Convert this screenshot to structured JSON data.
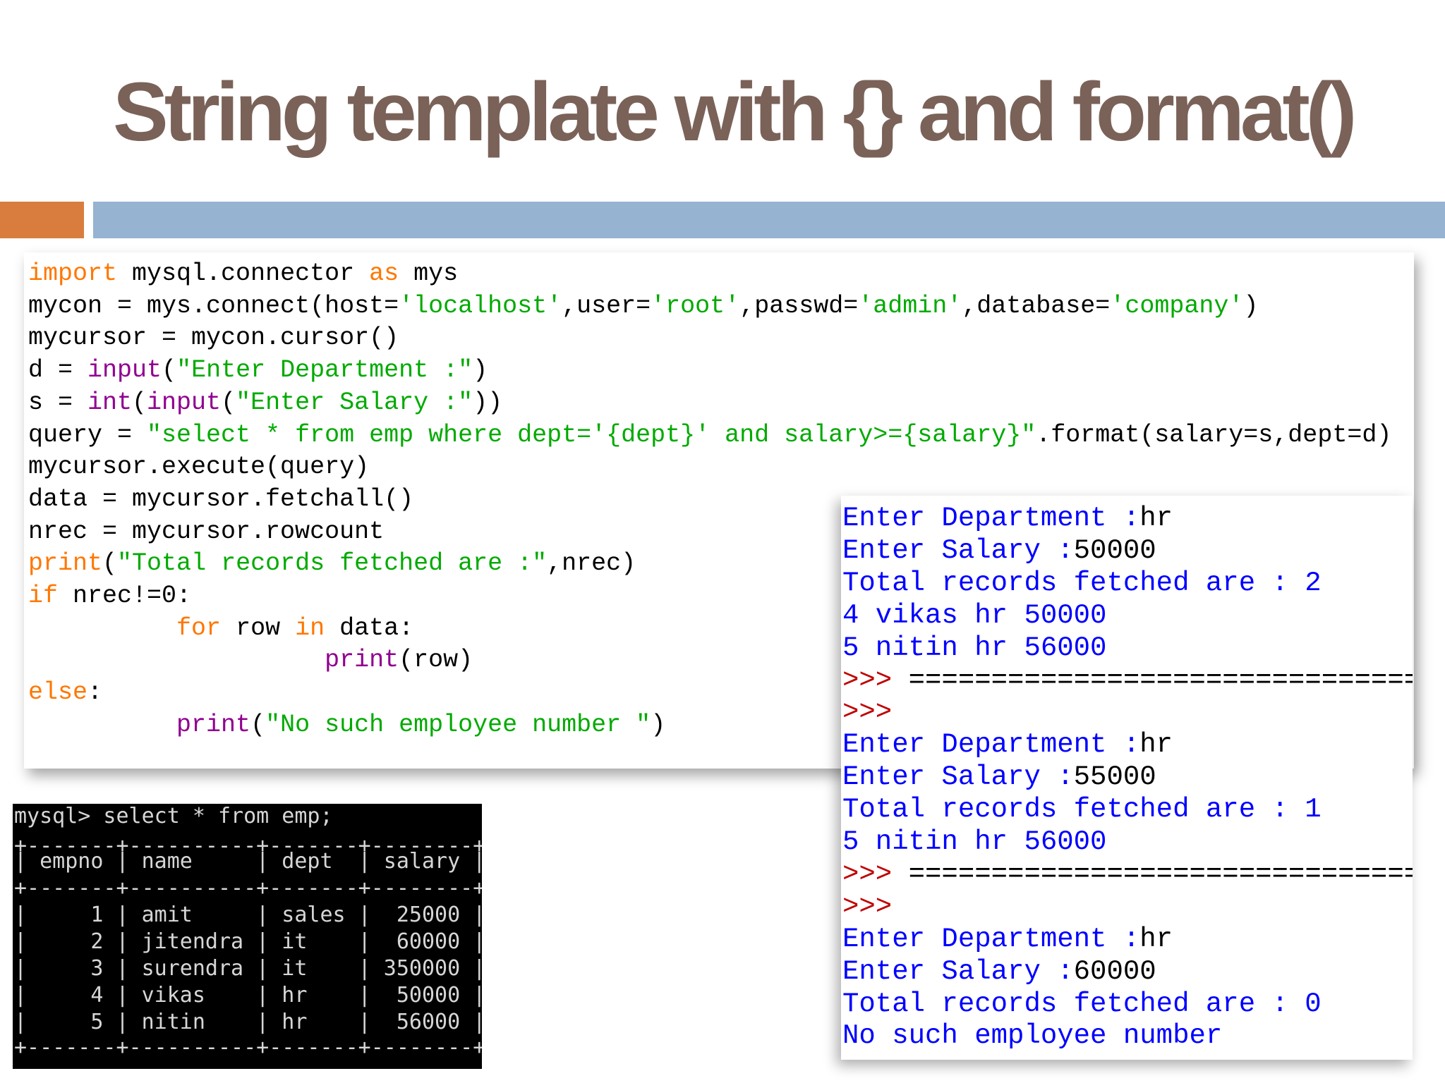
{
  "slide": {
    "title": "String template with {} and format()",
    "colors": {
      "title": "#7a6259",
      "accent_bar": "#d97d3e",
      "main_bar": "#96b4d1",
      "keyword": "#ff7700",
      "builtin": "#900090",
      "string": "#00aa00",
      "output_blue": "#0000ff",
      "prompt_red": "#c00000",
      "console_bg": "#000000",
      "console_text": "#d6d6d6"
    }
  },
  "code": {
    "lines": [
      [
        {
          "t": "import",
          "c": "kw"
        },
        {
          "t": " mysql.connector "
        },
        {
          "t": "as",
          "c": "kw"
        },
        {
          "t": " mys"
        }
      ],
      [
        {
          "t": "mycon = mys.connect(host="
        },
        {
          "t": "'localhost'",
          "c": "str"
        },
        {
          "t": ",user="
        },
        {
          "t": "'root'",
          "c": "str"
        },
        {
          "t": ",passwd="
        },
        {
          "t": "'admin'",
          "c": "str"
        },
        {
          "t": ",database="
        },
        {
          "t": "'company'",
          "c": "str"
        },
        {
          "t": ")"
        }
      ],
      [
        {
          "t": "mycursor = mycon.cursor()"
        }
      ],
      [
        {
          "t": "d = "
        },
        {
          "t": "input",
          "c": "bi"
        },
        {
          "t": "("
        },
        {
          "t": "\"Enter Department :\"",
          "c": "str"
        },
        {
          "t": ")"
        }
      ],
      [
        {
          "t": "s = "
        },
        {
          "t": "int",
          "c": "bi"
        },
        {
          "t": "("
        },
        {
          "t": "input",
          "c": "bi"
        },
        {
          "t": "("
        },
        {
          "t": "\"Enter Salary :\"",
          "c": "str"
        },
        {
          "t": "))"
        }
      ],
      [
        {
          "t": "query = "
        },
        {
          "t": "\"select * from emp where dept='{dept}' and salary>={salary}\"",
          "c": "str"
        },
        {
          "t": ".format(salary=s,dept=d)"
        }
      ],
      [
        {
          "t": "mycursor.execute(query)"
        }
      ],
      [
        {
          "t": "data = mycursor.fetchall()"
        }
      ],
      [
        {
          "t": "nrec = mycursor.rowcount"
        }
      ],
      [
        {
          "t": "print",
          "c": "kw"
        },
        {
          "t": "("
        },
        {
          "t": "\"Total records fetched are :\"",
          "c": "str"
        },
        {
          "t": ",nrec)"
        }
      ],
      [
        {
          "t": "if",
          "c": "kw"
        },
        {
          "t": " nrec!=0:"
        }
      ],
      [
        {
          "t": "          "
        },
        {
          "t": "for",
          "c": "kw"
        },
        {
          "t": " row "
        },
        {
          "t": "in",
          "c": "kw"
        },
        {
          "t": " data:"
        }
      ],
      [
        {
          "t": "                    "
        },
        {
          "t": "print",
          "c": "bi"
        },
        {
          "t": "(row)"
        }
      ],
      [
        {
          "t": "else",
          "c": "kw"
        },
        {
          "t": ":"
        }
      ],
      [
        {
          "t": "          "
        },
        {
          "t": "print",
          "c": "bi"
        },
        {
          "t": "("
        },
        {
          "t": "\"No such employee number \"",
          "c": "str"
        },
        {
          "t": ")"
        }
      ]
    ]
  },
  "mysql": {
    "lines": [
      "mysql> select * from emp;",
      "+-------+----------+-------+--------+",
      "| empno | name     | dept  | salary |",
      "+-------+----------+-------+--------+",
      "|     1 | amit     | sales |  25000 |",
      "|     2 | jitendra | it    |  60000 |",
      "|     3 | surendra | it    | 350000 |",
      "|     4 | vikas    | hr    |  50000 |",
      "|     5 | nitin    | hr    |  56000 |",
      "+-------+----------+-------+--------+"
    ]
  },
  "output": {
    "lines": [
      {
        "t": "Enter Department :hr",
        "c": "mix"
      },
      {
        "t": "Enter Salary :50000",
        "c": "mix"
      },
      {
        "t": "Total records fetched are : 2",
        "c": "blue"
      },
      {
        "t": "4 vikas hr 50000",
        "c": "blue"
      },
      {
        "t": "5 nitin hr 56000",
        "c": "blue"
      },
      {
        "t": ">>> =================================",
        "c": "prompt"
      },
      {
        "t": ">>>",
        "c": "prompt"
      },
      {
        "t": "Enter Department :hr",
        "c": "mix"
      },
      {
        "t": "Enter Salary :55000",
        "c": "mix"
      },
      {
        "t": "Total records fetched are : 1",
        "c": "blue"
      },
      {
        "t": "5 nitin hr 56000",
        "c": "blue"
      },
      {
        "t": ">>> =================================",
        "c": "prompt"
      },
      {
        "t": ">>>",
        "c": "prompt"
      },
      {
        "t": "Enter Department :hr",
        "c": "mix"
      },
      {
        "t": "Enter Salary :60000",
        "c": "mix"
      },
      {
        "t": "Total records fetched are : 0",
        "c": "blue"
      },
      {
        "t": "No such employee number",
        "c": "blue"
      }
    ]
  }
}
